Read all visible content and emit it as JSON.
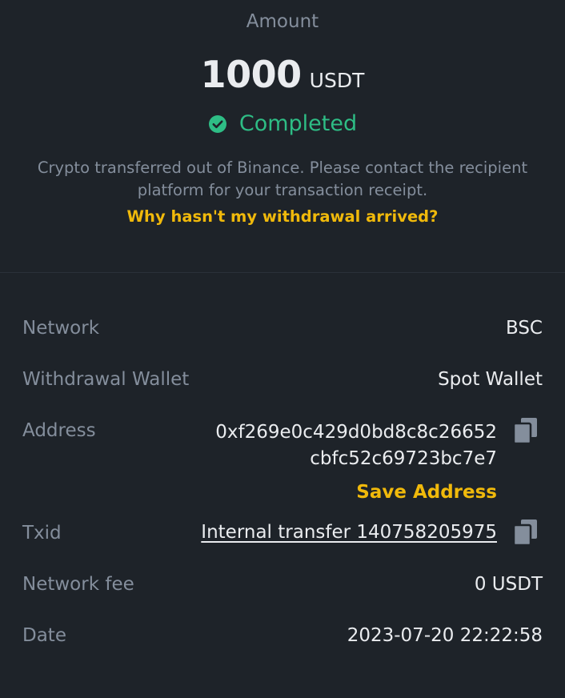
{
  "summary": {
    "amount_label": "Amount",
    "amount_value": "1000",
    "amount_unit": "USDT",
    "status": "Completed",
    "status_icon": "check-circle-icon",
    "description": "Crypto transferred out of Binance. Please contact the recipient platform for your transaction receipt.",
    "help_link": "Why hasn't my withdrawal arrived?"
  },
  "details": {
    "network": {
      "label": "Network",
      "value": "BSC"
    },
    "wallet": {
      "label": "Withdrawal Wallet",
      "value": "Spot Wallet"
    },
    "address": {
      "label": "Address",
      "value": "0xf269e0c429d0bd8c8c26652cbfc52c69723bc7e7",
      "save_label": "Save Address",
      "copy_icon": "copy-icon"
    },
    "txid": {
      "label": "Txid",
      "value": "Internal transfer 140758205975",
      "copy_icon": "copy-icon"
    },
    "fee": {
      "label": "Network fee",
      "value": "0 USDT"
    },
    "date": {
      "label": "Date",
      "value": "2023-07-20 22:22:58"
    }
  },
  "colors": {
    "background": "#1e2329",
    "success": "#2ebd85",
    "accent": "#f0b90b",
    "text_primary": "#eaecef",
    "text_secondary": "#848e9c"
  }
}
